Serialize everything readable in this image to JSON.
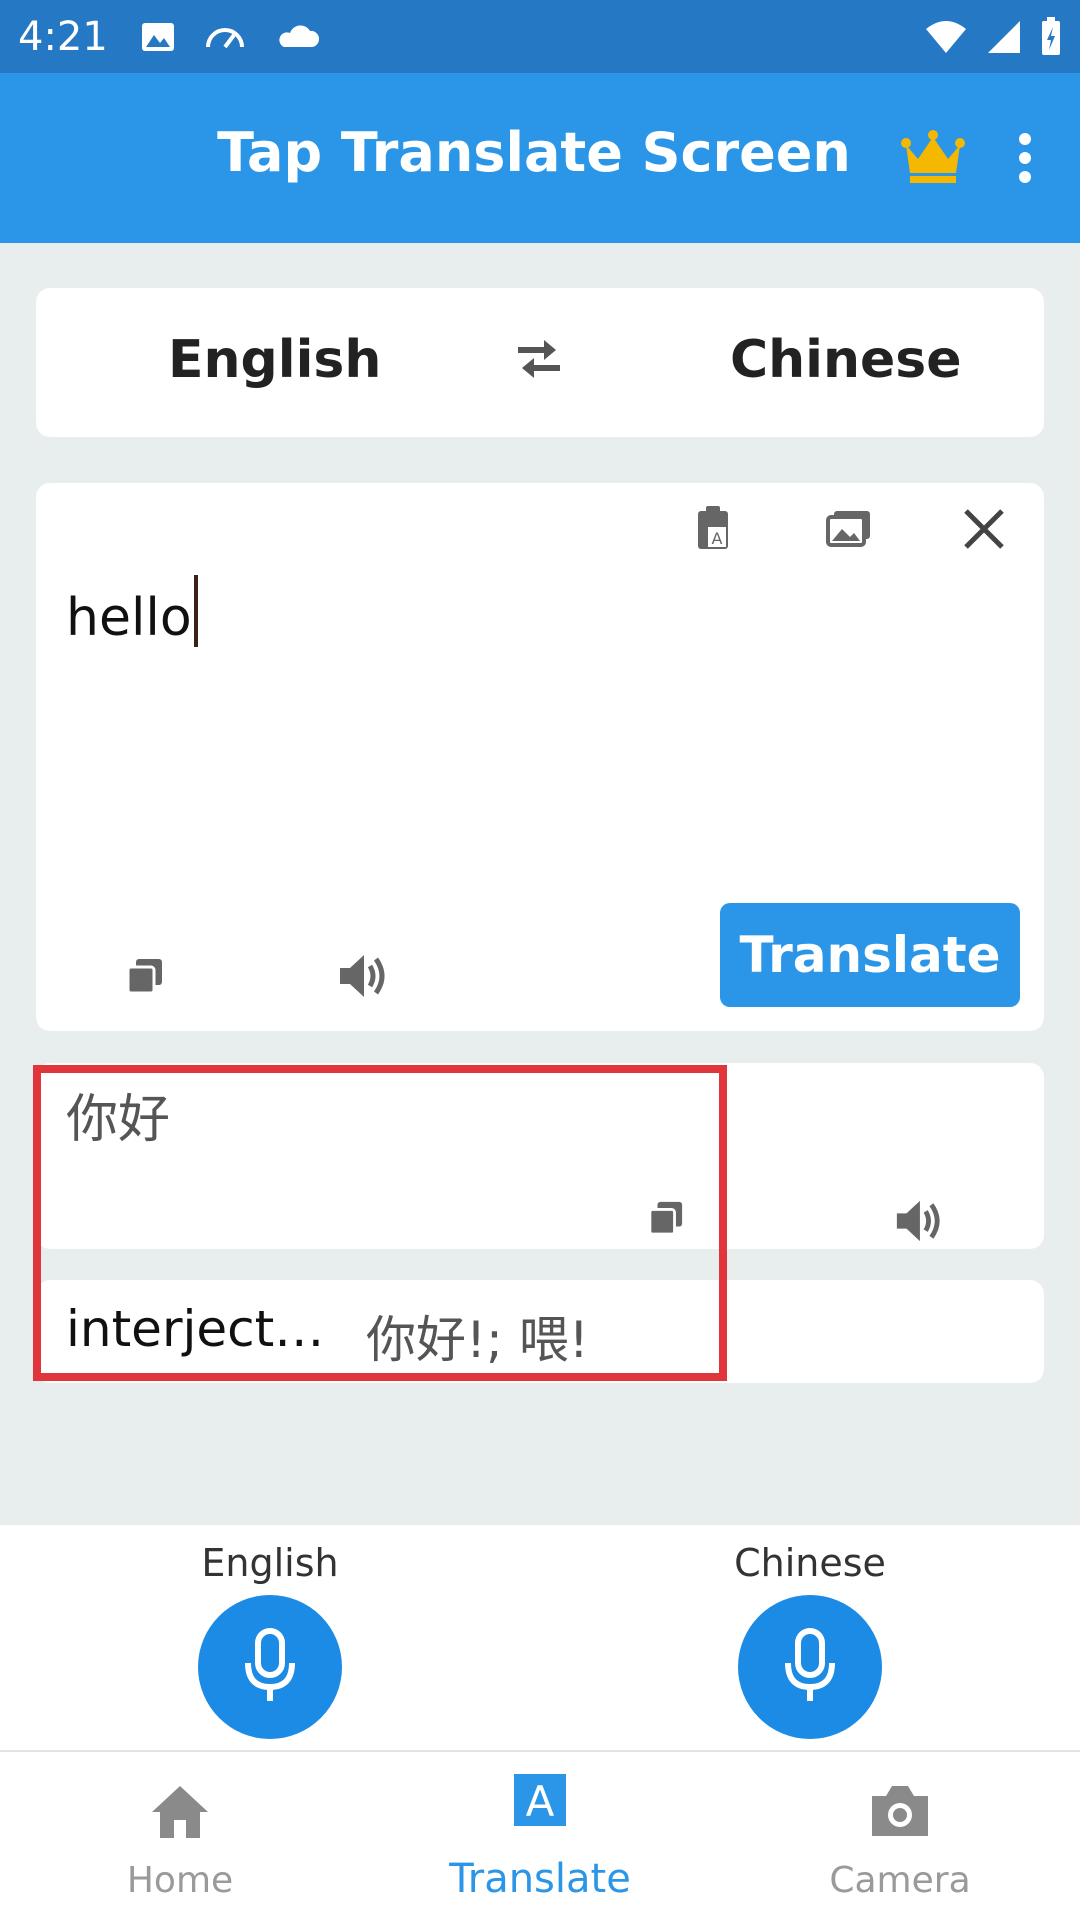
{
  "status_bar": {
    "time": "4:21",
    "icons_left": [
      "image-icon",
      "speedometer-icon",
      "cloud-icon"
    ],
    "icons_right": [
      "wifi-icon",
      "signal-icon",
      "battery-charging-icon"
    ]
  },
  "app_bar": {
    "title": "Tap Translate Screen",
    "icons": [
      "crown-icon",
      "more-vert-icon"
    ],
    "accent": "#2b96e8",
    "crown_color": "#f5b800"
  },
  "languages": {
    "source": "English",
    "target": "Chinese"
  },
  "input": {
    "text": "hello"
  },
  "buttons": {
    "translate": "Translate"
  },
  "result": {
    "text": "你好"
  },
  "dictionary": {
    "part_of_speech": "interject…",
    "definition": "你好!; 喂!"
  },
  "voice": {
    "left_label": "English",
    "right_label": "Chinese"
  },
  "nav": {
    "items": [
      {
        "label": "Home",
        "icon": "home-icon",
        "active": false
      },
      {
        "label": "Translate",
        "icon": "translate-icon",
        "active": true
      },
      {
        "label": "Camera",
        "icon": "camera-icon",
        "active": false
      }
    ]
  },
  "highlight_color": "#e0353b"
}
